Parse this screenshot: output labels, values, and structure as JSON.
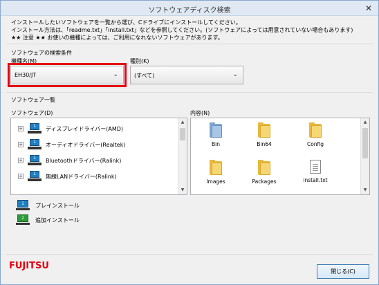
{
  "window": {
    "title": "ソフトウェアディスク検索"
  },
  "intro": {
    "line1": "インストールしたいソフトウェアを一覧から選び、Cドライブにインストールしてください。",
    "line2": "インストール方法は、「readme.txt」「install.txt」などを参照してください。(ソフトウェアによっては用意されていない場合もあります)",
    "line3": "★★ 注意 ★★ お使いの機種によっては、ご利用になれないソフトウェアがあります。"
  },
  "search_conditions": {
    "title": "ソフトウェアの検索条件",
    "model_label": "機種名(M)",
    "model_value": "EH30/JT",
    "type_label": "種別(K)",
    "type_value": "(すべて)"
  },
  "software_list": {
    "title": "ソフトウェア一覧",
    "software_label": "ソフトウェア(D)",
    "content_label": "内容(N)",
    "items": [
      {
        "label": "ディスプレイドライバー(AMD)",
        "badge": "1"
      },
      {
        "label": "オーディオドライバー(Realtek)",
        "badge": "1"
      },
      {
        "label": "Bluetoothドライバー(Ralink)",
        "badge": "1"
      },
      {
        "label": "無線LANドライバー(Ralink)",
        "badge": "1"
      }
    ],
    "files": [
      {
        "name": "Bin",
        "kind": "folder-selected"
      },
      {
        "name": "Bin64",
        "kind": "folder"
      },
      {
        "name": "Config",
        "kind": "folder"
      },
      {
        "name": "Images",
        "kind": "folder"
      },
      {
        "name": "Packages",
        "kind": "folder"
      },
      {
        "name": "install.txt",
        "kind": "text"
      }
    ]
  },
  "legend": {
    "preinstall": {
      "label": "プレインストール",
      "badge": "1",
      "color": "#1e7fc1"
    },
    "additional": {
      "label": "追加インストール",
      "badge": "2",
      "color": "#2e9a3c"
    }
  },
  "footer": {
    "logo": "FUJITSU",
    "close_label": "閉じる(C)"
  },
  "colors": {
    "accent_red": "#e60012"
  }
}
